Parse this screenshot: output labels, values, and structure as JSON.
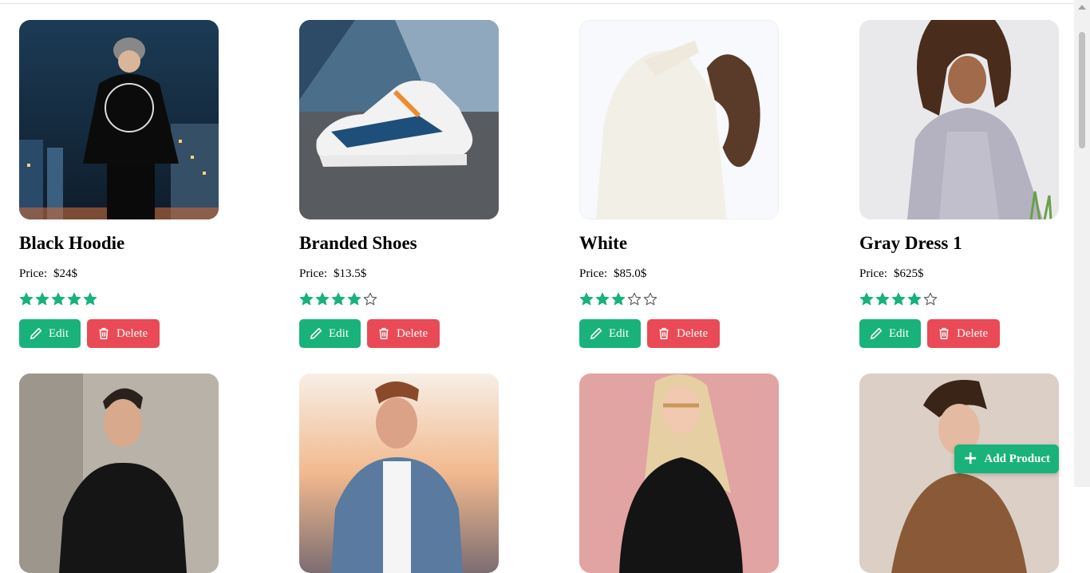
{
  "products": [
    {
      "title": "Black Hoodie",
      "price_label": "Price:",
      "price": "$24$",
      "rating": 5,
      "image_icon": "black-hoodie-photo"
    },
    {
      "title": "Branded Shoes",
      "price_label": "Price:",
      "price": "$13.5$",
      "rating": 4,
      "image_icon": "sneaker-photo"
    },
    {
      "title": "White",
      "price_label": "Price:",
      "price": "$85.0$",
      "rating": 3,
      "image_icon": "white-top-photo"
    },
    {
      "title": "Gray Dress 1",
      "price_label": "Price:",
      "price": "$625$",
      "rating": 4,
      "image_icon": "gray-dress-photo"
    }
  ],
  "buttons": {
    "edit": "Edit",
    "delete": "Delete",
    "add_product": "Add Product"
  },
  "colors": {
    "accent_green": "#19b27b",
    "danger_red": "#ea4a55",
    "star_green": "#19b27b"
  }
}
